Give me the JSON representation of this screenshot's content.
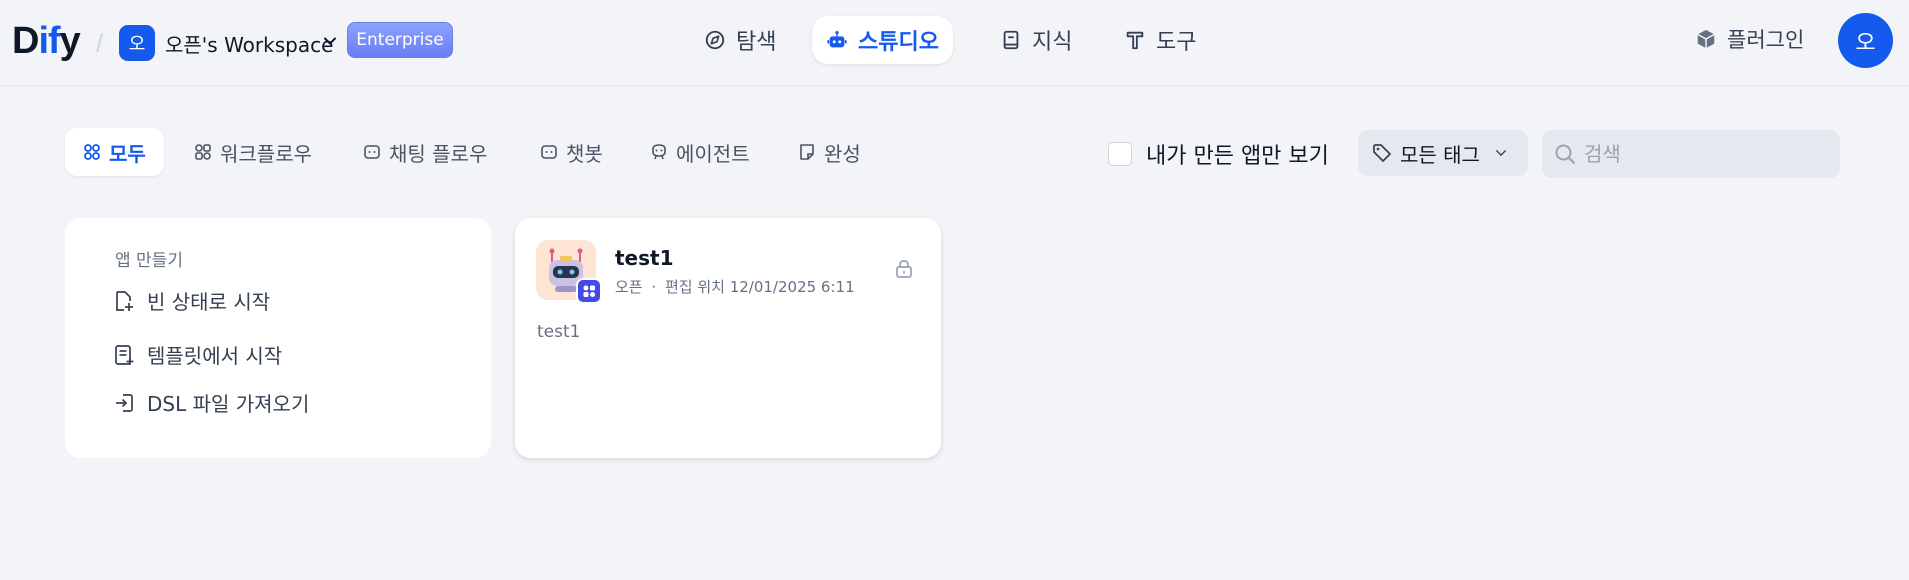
{
  "header": {
    "logo_prefix": "D",
    "logo_accent": "if",
    "logo_suffix": "y",
    "workspace_initial": "오",
    "workspace_name": "오픈's Workspace",
    "plan_badge": "Enterprise",
    "nav": [
      {
        "label": "탐색",
        "icon": "compass-icon"
      },
      {
        "label": "스튜디오",
        "icon": "robot-icon",
        "active": true
      },
      {
        "label": "지식",
        "icon": "book-icon"
      },
      {
        "label": "도구",
        "icon": "hammer-icon"
      }
    ],
    "plugin_label": "플러그인",
    "user_initial": "오"
  },
  "filters": {
    "tabs": [
      {
        "label": "모두",
        "icon": "grid-icon",
        "active": true
      },
      {
        "label": "워크플로우",
        "icon": "workflow-icon"
      },
      {
        "label": "채팅 플로우",
        "icon": "chatflow-icon"
      },
      {
        "label": "챗봇",
        "icon": "chatbot-icon"
      },
      {
        "label": "에이전트",
        "icon": "agent-icon"
      },
      {
        "label": "완성",
        "icon": "completion-icon"
      }
    ],
    "mine_only_label": "내가 만든 앱만 보기",
    "mine_only_checked": false,
    "tag_label": "모든 태그",
    "search_placeholder": "검색"
  },
  "create_card": {
    "title": "앱 만들기",
    "items": [
      {
        "label": "빈 상태로 시작",
        "icon": "file-plus-icon"
      },
      {
        "label": "템플릿에서 시작",
        "icon": "template-icon"
      },
      {
        "label": "DSL 파일 가져오기",
        "icon": "import-icon"
      }
    ]
  },
  "apps": [
    {
      "name": "test1",
      "author": "오픈",
      "meta_sep": "·",
      "edited_label": "편집 위치",
      "edited_at": "12/01/2025 6:11",
      "description": "test1"
    }
  ],
  "colors": {
    "accent": "#155aef",
    "background": "#f2f4f7",
    "enterprise_badge": "#7b8ef8",
    "app_badge": "#444ce7"
  }
}
